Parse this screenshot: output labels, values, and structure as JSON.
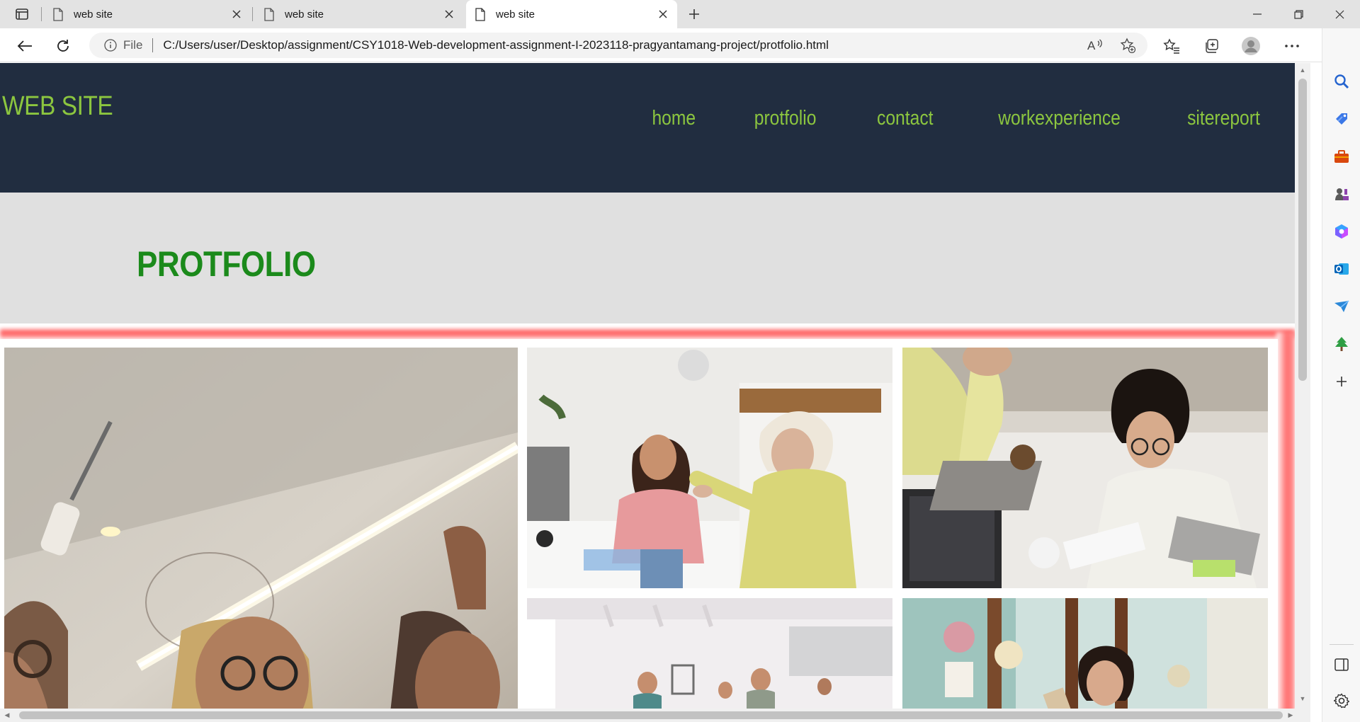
{
  "browser": {
    "tabs": [
      {
        "title": "web site",
        "active": false
      },
      {
        "title": "web site",
        "active": false
      },
      {
        "title": "web site",
        "active": true
      }
    ],
    "address": {
      "scheme_label": "File",
      "url": "C:/Users/user/Desktop/assignment/CSY1018-Web-development-assignment-I-2023118-pragyantamang-project/protfolio.html"
    },
    "icons": {
      "tab_sidebar": "tab-actions-icon",
      "back": "back-arrow-icon",
      "refresh": "refresh-icon",
      "info": "info-icon",
      "read_aloud": "read-aloud-icon",
      "add_favorite": "add-favorite-icon",
      "favorites": "favorites-icon",
      "collections": "collections-icon",
      "profile": "profile-avatar-icon",
      "more": "more-icon",
      "bing": "bing-copilot-icon"
    },
    "sidebar_icons": [
      "search-icon",
      "shopping-tag-icon",
      "tools-icon",
      "games-icon",
      "microsoft-365-icon",
      "outlook-icon",
      "drop-icon",
      "tree-icon",
      "add-icon",
      "split-screen-icon",
      "settings-icon"
    ]
  },
  "site": {
    "logo": "WEB SITE",
    "nav": [
      "home",
      "protfolio",
      "contact",
      "workexperience",
      "sitereport"
    ],
    "page_title": "PROTFOLIO",
    "colors": {
      "header_bg": "#212d40",
      "accent_green": "#8cc63f",
      "title_green": "#1b8a1b",
      "title_band": "#e0e0e0",
      "glow_red": "#ff5a5a"
    },
    "photos": [
      {
        "name": "photo-team-whiteboard"
      },
      {
        "name": "photo-office-discussion"
      },
      {
        "name": "photo-women-laptops"
      },
      {
        "name": "photo-team-meeting-room"
      },
      {
        "name": "photo-woman-shop"
      }
    ]
  }
}
